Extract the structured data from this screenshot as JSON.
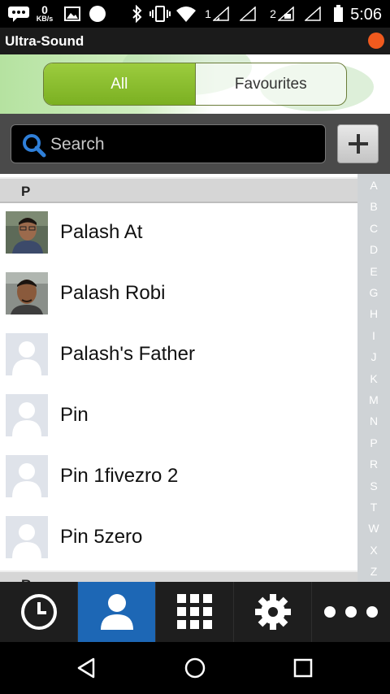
{
  "status_bar": {
    "speed_value": "0",
    "speed_unit": "KB/s",
    "sim1_label": "1",
    "sim2_label": "2",
    "time": "5:06",
    "icons": [
      "message-icon",
      "image-icon",
      "circle-icon",
      "bluetooth-icon",
      "vibrate-icon",
      "wifi-icon",
      "signal-icon",
      "battery-icon"
    ]
  },
  "app": {
    "title": "Ultra-Sound",
    "record_color": "#f05a1e"
  },
  "tabs": [
    {
      "label": "All",
      "selected": true
    },
    {
      "label": "Favourites",
      "selected": false
    }
  ],
  "search": {
    "placeholder": "Search",
    "value": ""
  },
  "contacts": {
    "sections": [
      {
        "letter": "P",
        "items": [
          {
            "name": "Palash At",
            "avatar": "photo"
          },
          {
            "name": "Palash Robi",
            "avatar": "photo"
          },
          {
            "name": "Palash's Father",
            "avatar": "placeholder"
          },
          {
            "name": "Pin",
            "avatar": "placeholder"
          },
          {
            "name": "Pin 1fivezro 2",
            "avatar": "placeholder"
          },
          {
            "name": "Pin 5zero",
            "avatar": "placeholder"
          }
        ]
      },
      {
        "letter": "R",
        "items": []
      }
    ]
  },
  "index_letters": [
    "A",
    "B",
    "C",
    "D",
    "E",
    "G",
    "H",
    "I",
    "J",
    "K",
    "M",
    "N",
    "P",
    "R",
    "S",
    "T",
    "W",
    "X",
    "Z"
  ],
  "bottom_nav": [
    {
      "name": "clock-icon",
      "active": false
    },
    {
      "name": "contacts-icon",
      "active": true
    },
    {
      "name": "dialpad-icon",
      "active": false
    },
    {
      "name": "gear-icon",
      "active": false
    },
    {
      "name": "more-icon",
      "active": false
    }
  ],
  "colors": {
    "accent": "#1d67b5",
    "tab_selected": "#8bbd2e",
    "index_bar": "#cfd3d6"
  }
}
